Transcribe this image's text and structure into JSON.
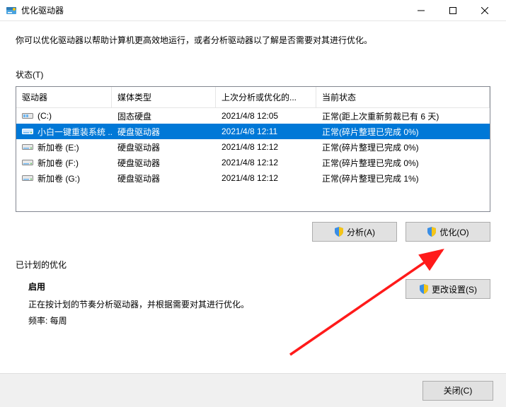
{
  "window": {
    "title": "优化驱动器"
  },
  "description": "你可以优化驱动器以帮助计算机更高效地运行，或者分析驱动器以了解是否需要对其进行优化。",
  "status_label": "状态(T)",
  "columns": {
    "drive": "驱动器",
    "type": "媒体类型",
    "last": "上次分析或优化的...",
    "status": "当前状态"
  },
  "drives": [
    {
      "name": "(C:)",
      "type": "固态硬盘",
      "last": "2021/4/8 12:05",
      "status": "正常(距上次重新剪裁已有 6 天)",
      "icon": "ssd",
      "selected": false
    },
    {
      "name": "小白一键重装系统 ...",
      "type": "硬盘驱动器",
      "last": "2021/4/8 12:11",
      "status": "正常(碎片整理已完成 0%)",
      "icon": "hdd",
      "selected": true
    },
    {
      "name": "新加卷 (E:)",
      "type": "硬盘驱动器",
      "last": "2021/4/8 12:12",
      "status": "正常(碎片整理已完成 0%)",
      "icon": "hdd",
      "selected": false
    },
    {
      "name": "新加卷 (F:)",
      "type": "硬盘驱动器",
      "last": "2021/4/8 12:12",
      "status": "正常(碎片整理已完成 0%)",
      "icon": "hdd",
      "selected": false
    },
    {
      "name": "新加卷 (G:)",
      "type": "硬盘驱动器",
      "last": "2021/4/8 12:12",
      "status": "正常(碎片整理已完成 1%)",
      "icon": "hdd",
      "selected": false
    }
  ],
  "buttons": {
    "analyze": "分析(A)",
    "optimize": "优化(O)",
    "change_settings": "更改设置(S)",
    "close": "关闭(C)"
  },
  "scheduled": {
    "header": "已计划的优化",
    "title": "启用",
    "line1": "正在按计划的节奏分析驱动器，并根据需要对其进行优化。",
    "line2": "频率: 每周"
  }
}
